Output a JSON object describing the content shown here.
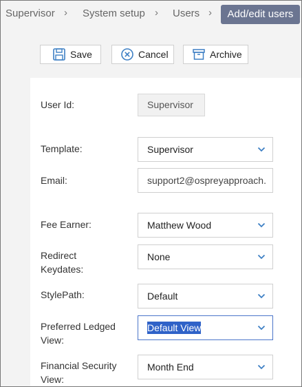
{
  "breadcrumb": {
    "items": [
      "Supervisor",
      "System setup",
      "Users"
    ],
    "active": "Add/edit users"
  },
  "toolbar": {
    "save_label": "Save",
    "cancel_label": "Cancel",
    "archive_label": "Archive"
  },
  "form": {
    "user_id": {
      "label": "User Id:",
      "value": "Supervisor"
    },
    "template": {
      "label": "Template:",
      "value": "Supervisor"
    },
    "email": {
      "label": "Email:",
      "value": "support2@ospreyapproach."
    },
    "fee_earner": {
      "label": "Fee Earner:",
      "value": "Matthew Wood"
    },
    "redirect_keydates": {
      "label_line1": "Redirect",
      "label_line2": "Keydates:",
      "value": "None"
    },
    "style_path": {
      "label": "StylePath:",
      "value": "Default"
    },
    "preferred_ledged_view": {
      "label_line1": "Preferred Ledged",
      "label_line2": "View:",
      "value": "Default View"
    },
    "financial_security_view": {
      "label_line1": "Financial Security",
      "label_line2": "View:",
      "value": "Month End"
    }
  },
  "colors": {
    "accent": "#6b7591",
    "icon_blue": "#3d7fc4",
    "selection": "#2f62c8"
  }
}
